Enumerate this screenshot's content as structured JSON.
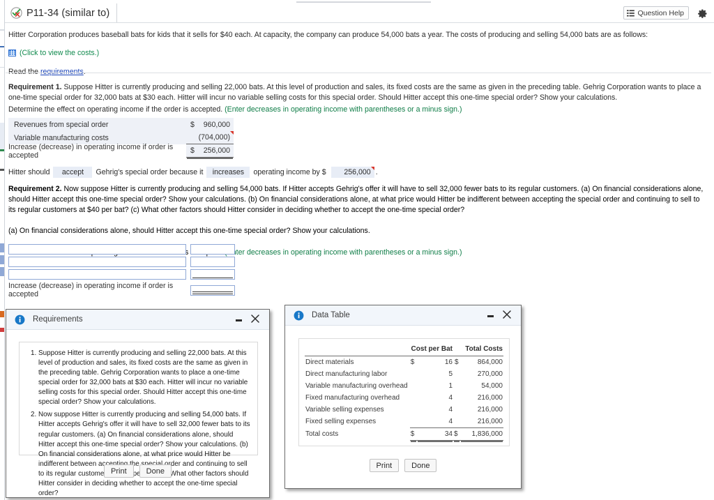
{
  "header": {
    "title": "P11-34 (similar to)",
    "status_icon": "check-x-icon",
    "question_help": "Question Help",
    "question_help_icon": "list-icon",
    "gear_icon": "gear-icon"
  },
  "intro": {
    "paragraph": "Hitter Corporation produces baseball bats for kids that it sells for $40 each. At capacity, the company can produce 54,000 bats a year. The costs of producing and selling 54,000 bats are as follows:",
    "costs_link_icon": "spreadsheet-icon",
    "costs_link": "(Click to view the costs.)",
    "read_prefix": "Read the ",
    "read_link": "requirements",
    "read_suffix": "."
  },
  "requirement1": {
    "label": "Requirement 1.",
    "text": " Suppose Hitter is currently producing and selling 22,000 bats. At this level of production and sales, its fixed costs are the same as given in the preceding table. Gehrig Corporation wants to place a one-time special order for 32,000 bats at $30 each. Hitter will incur no variable selling costs for this special order. Should Hitter accept this one-time special order? Show your calculations.",
    "determine": "Determine the effect on operating income if the order is accepted. ",
    "determine_note": "(Enter decreases in operating income with parentheses or a minus sign.)",
    "table": [
      {
        "label": "Revenues from special order",
        "currency": "$",
        "value": "960,000",
        "flag": false
      },
      {
        "label": "Variable manufacturing costs",
        "currency": "",
        "value": "(704,000)",
        "flag": true
      },
      {
        "label": "Increase (decrease) in operating income if order is accepted",
        "currency": "$",
        "value": "256,000",
        "flag": false
      }
    ],
    "sentence": {
      "lead": "Hitter should",
      "choice1": "accept",
      "mid": "Gehrig's special order because it",
      "choice2": "increases",
      "tail": "operating income by $",
      "amount": "256,000",
      "period": "."
    }
  },
  "requirement2": {
    "label": "Requirement 2.",
    "text": " Now suppose Hitter is currently producing and selling 54,000 bats. If Hitter accepts Gehrig's offer it will have to sell 32,000 fewer bats to its regular customers. (a) On financial considerations alone, should Hitter accept this one-time special order? Show your calculations. (b) On financial considerations alone, at what price would Hitter be indifferent between accepting the special order and continuing to sell to its regular customers at $40 per bat? (c) What other factors should Hitter consider in deciding whether to accept the one-time special order?",
    "part_a": "(a) On financial considerations alone, should Hitter accept this one-time special order? Show your calculations.",
    "determine": "Determine the effect on operating income if the order is accepted. ",
    "determine_note": "(Enter decreases in operating income with parentheses or a minus sign.)",
    "blank_rows": [
      {
        "label": "",
        "value": ""
      },
      {
        "label": "",
        "value": ""
      },
      {
        "label": "",
        "value": ""
      }
    ],
    "last_label": "Increase (decrease) in operating income if order is accepted",
    "last_value": ""
  },
  "requirements_dialog": {
    "icon": "info-icon",
    "title": "Requirements",
    "minimize_icon": "minimize-icon",
    "close_icon": "close-icon",
    "items": [
      "Suppose Hitter is currently producing and selling 22,000 bats. At this level of production and sales, its fixed costs are the same as given in the preceding table. Gehrig Corporation wants to place a one-time special order for 32,000 bats at $30 each. Hitter will incur no variable selling costs for this special order. Should Hitter accept this one-time special order? Show your calculations.",
      "Now suppose Hitter is currently producing and selling 54,000 bats. If Hitter accepts Gehrig's offer it will have to sell 32,000 fewer bats to its regular customers. (a) On financial considerations alone, should Hitter accept this one-time special order? Show your calculations. (b) On financial considerations alone, at what price would Hitter be indifferent between accepting the special order and continuing to sell to its regular customers at $40 per bat? (c) What other factors should Hitter consider in deciding whether to accept the one-time special order?"
    ],
    "print_label": "Print",
    "done_label": "Done"
  },
  "data_table_dialog": {
    "icon": "info-icon",
    "title": "Data Table",
    "minimize_icon": "minimize-icon",
    "close_icon": "close-icon",
    "columns": [
      "",
      "Cost per Bat",
      "Total Costs"
    ],
    "rows": [
      {
        "label": "Direct materials",
        "cur1": "$",
        "cost": "16",
        "cur2": "$",
        "total": "864,000"
      },
      {
        "label": "Direct manufacturing labor",
        "cur1": "",
        "cost": "5",
        "cur2": "",
        "total": "270,000"
      },
      {
        "label": "Variable manufacturing overhead",
        "cur1": "",
        "cost": "1",
        "cur2": "",
        "total": "54,000"
      },
      {
        "label": "Fixed manufacturing overhead",
        "cur1": "",
        "cost": "4",
        "cur2": "",
        "total": "216,000"
      },
      {
        "label": "Variable selling expenses",
        "cur1": "",
        "cost": "4",
        "cur2": "",
        "total": "216,000"
      },
      {
        "label": "Fixed selling expenses",
        "cur1": "",
        "cost": "4",
        "cur2": "",
        "total": "216,000"
      }
    ],
    "total_row": {
      "label": "Total costs",
      "cur1": "$",
      "cost": "34",
      "cur2": "$",
      "total": "1,836,000"
    },
    "print_label": "Print",
    "done_label": "Done"
  }
}
